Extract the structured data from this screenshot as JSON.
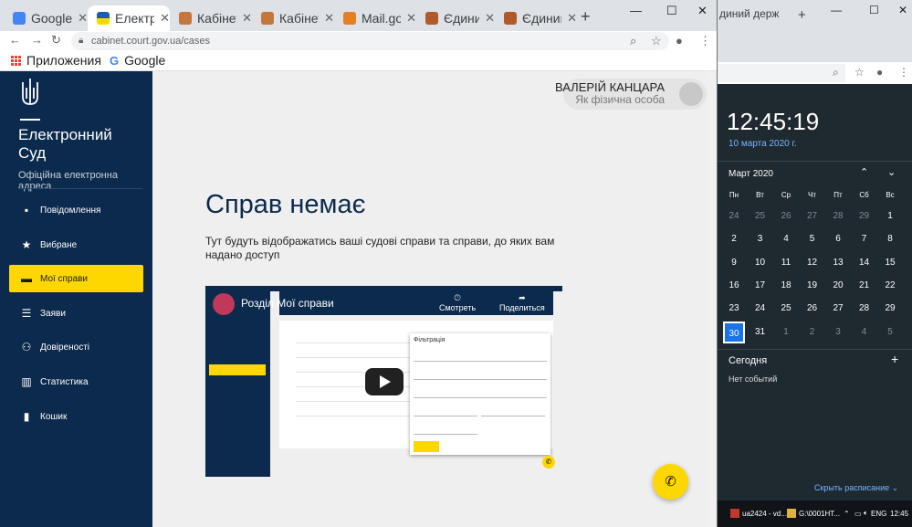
{
  "browser": {
    "tabs": [
      {
        "title": "Google",
        "active": false,
        "color": "#4285f4"
      },
      {
        "title": "Електро",
        "active": true,
        "color": "#ffd700"
      },
      {
        "title": "Кабінет",
        "active": false,
        "color": "#c4763b"
      },
      {
        "title": "Кабінет",
        "active": false,
        "color": "#c4763b"
      },
      {
        "title": "Mail.gov",
        "active": false,
        "color": "#e67e22"
      },
      {
        "title": "Єдиний",
        "active": false,
        "color": "#b05a2a"
      },
      {
        "title": "Єдиний",
        "active": false,
        "color": "#b05a2a"
      }
    ],
    "url": "cabinet.court.gov.ua/cases",
    "bookmarks": {
      "apps": "Приложения",
      "google": "Google"
    }
  },
  "sidebar": {
    "brand": "Електронний Суд",
    "subtitle": "Офіційна електронна адреса",
    "items": [
      {
        "label": "Повідомлення",
        "icon": "message-icon",
        "glyph": "▪",
        "active": false
      },
      {
        "label": "Вибране",
        "icon": "star-icon",
        "glyph": "★",
        "active": false
      },
      {
        "label": "Мої справи",
        "icon": "folder-icon",
        "glyph": "▬",
        "active": true
      },
      {
        "label": "Заяви",
        "icon": "list-icon",
        "glyph": "☰",
        "active": false
      },
      {
        "label": "Довіреності",
        "icon": "people-icon",
        "glyph": "⚇",
        "active": false
      },
      {
        "label": "Статистика",
        "icon": "chart-icon",
        "glyph": "▥",
        "active": false
      },
      {
        "label": "Кошик",
        "icon": "trash-icon",
        "glyph": "▮",
        "active": false
      }
    ]
  },
  "user": {
    "name": "ВАЛЕРІЙ КАНЦАРА",
    "role": "Як фізична особа"
  },
  "main": {
    "heading": "Справ немає",
    "description": "Тут будуть відображатись ваші судові справи та справи, до яких вам надано доступ"
  },
  "video": {
    "title": "Розділ Мої справи",
    "watch_later": "Смотреть",
    "share": "Поделиться",
    "filter_title": "Фільтрація"
  },
  "clock": {
    "time": "12:45:19",
    "date": "10 марта 2020 г.",
    "month": "Март 2020",
    "weekdays": [
      "Пн",
      "Вт",
      "Ср",
      "Чт",
      "Пт",
      "Сб",
      "Вс"
    ],
    "weeks": [
      [
        "24",
        "25",
        "26",
        "27",
        "28",
        "29",
        "1"
      ],
      [
        "2",
        "3",
        "4",
        "5",
        "6",
        "7",
        "8"
      ],
      [
        "9",
        "10",
        "11",
        "12",
        "13",
        "14",
        "15"
      ],
      [
        "16",
        "17",
        "18",
        "19",
        "20",
        "21",
        "22"
      ],
      [
        "23",
        "24",
        "25",
        "26",
        "27",
        "28",
        "29"
      ],
      [
        "30",
        "31",
        "1",
        "2",
        "3",
        "4",
        "5"
      ]
    ],
    "today_label": "Сегодня",
    "no_events": "Нет событий",
    "schedule_link": "Скрыть расписание"
  },
  "second_window": {
    "tab_title": "диний держ"
  },
  "taskbar": {
    "items": [
      "ua2424 - vd...",
      "G:\\0001HT..."
    ],
    "lang": "ENG",
    "time": "12:45"
  }
}
